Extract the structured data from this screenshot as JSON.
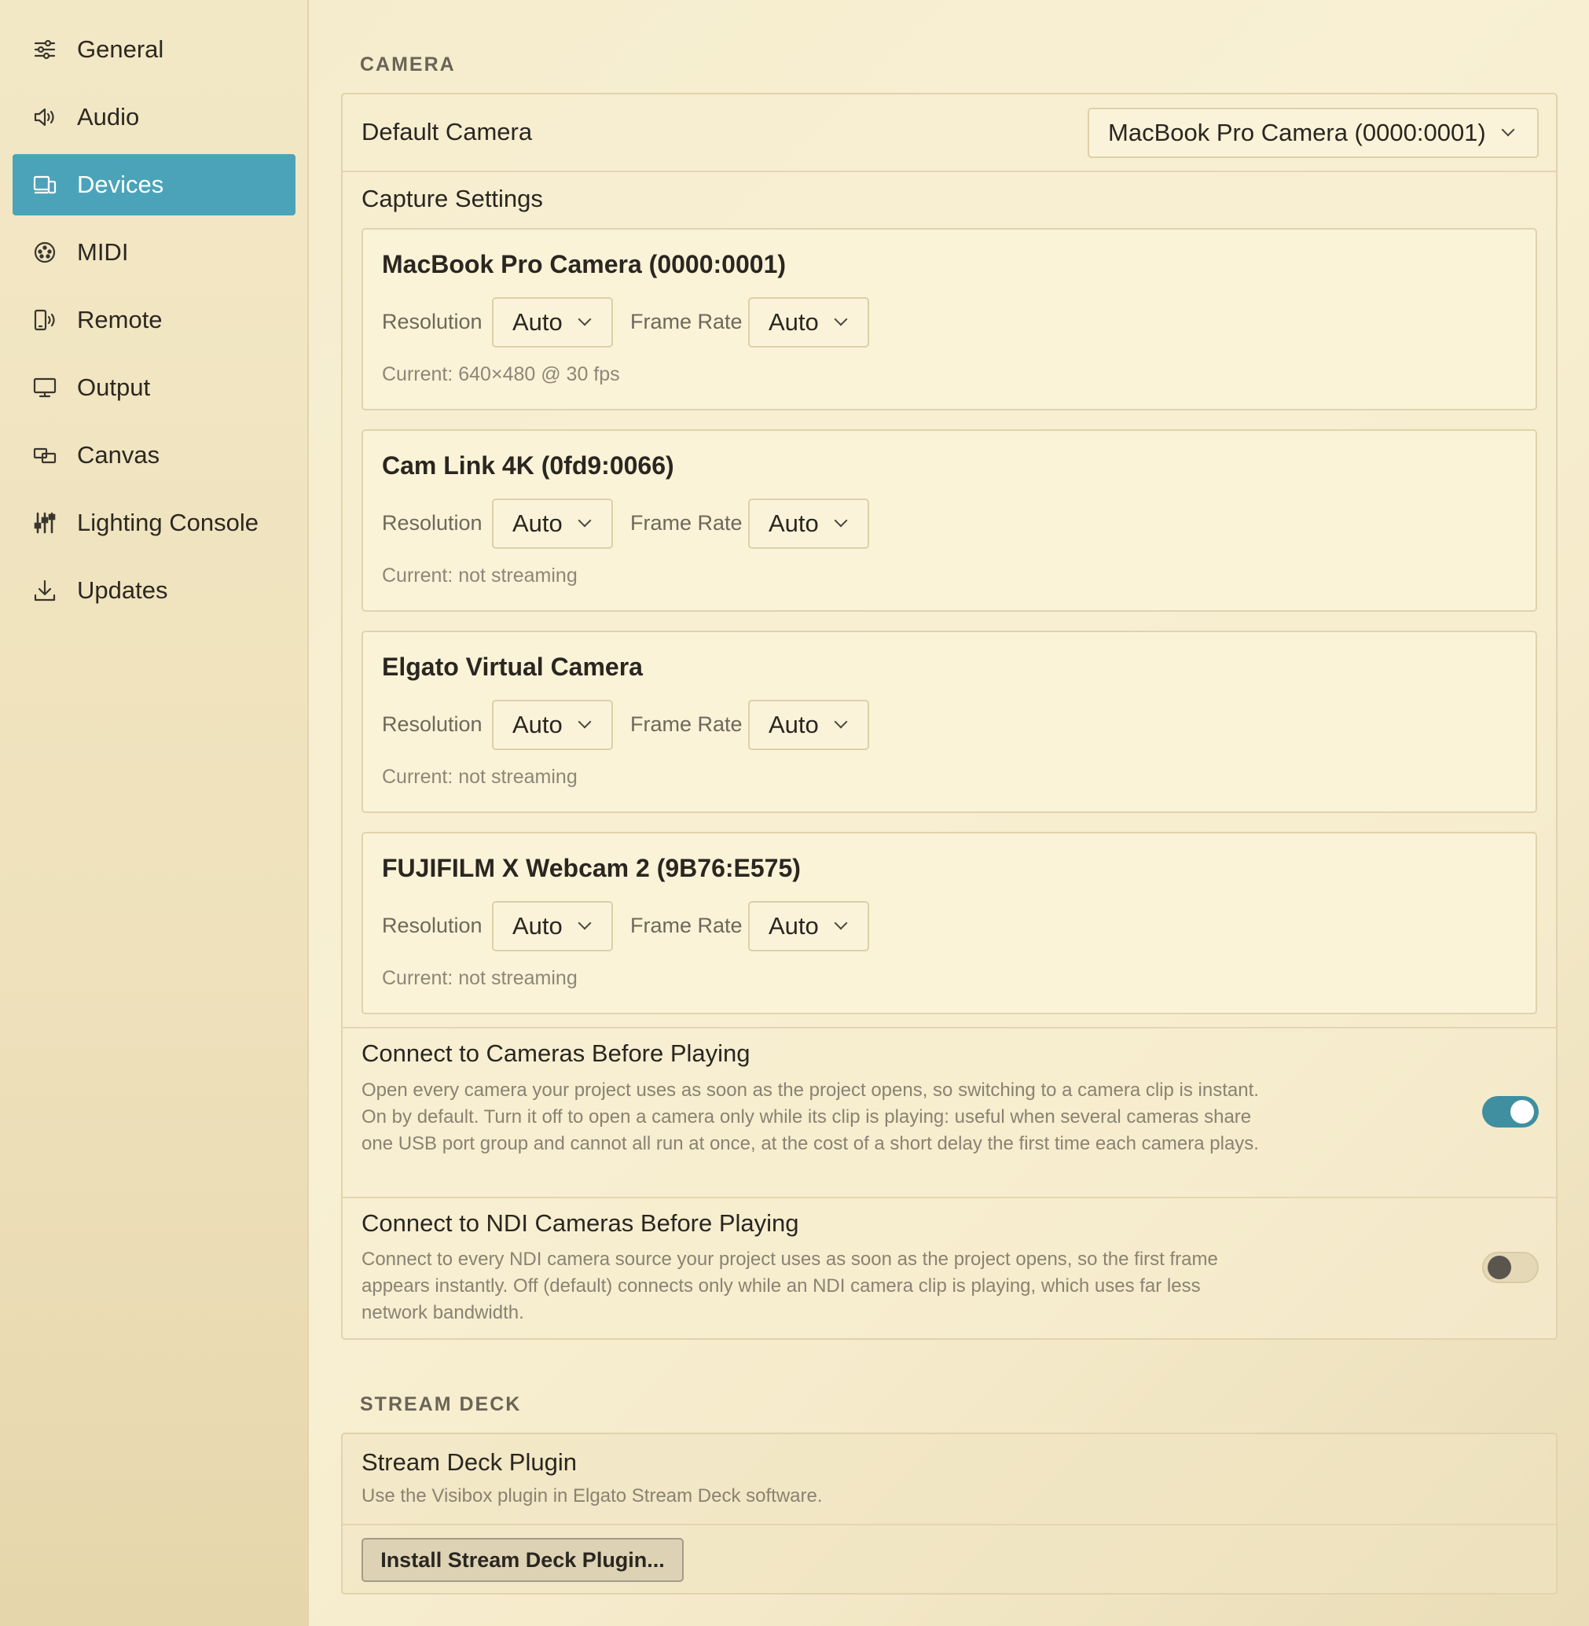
{
  "sidebar": {
    "items": [
      {
        "label": "General",
        "icon": "sliders-icon",
        "active": false
      },
      {
        "label": "Audio",
        "icon": "speaker-icon",
        "active": false
      },
      {
        "label": "Devices",
        "icon": "devices-icon",
        "active": true
      },
      {
        "label": "MIDI",
        "icon": "midi-icon",
        "active": false
      },
      {
        "label": "Remote",
        "icon": "remote-icon",
        "active": false
      },
      {
        "label": "Output",
        "icon": "monitor-icon",
        "active": false
      },
      {
        "label": "Canvas",
        "icon": "canvas-icon",
        "active": false
      },
      {
        "label": "Lighting Console",
        "icon": "faders-icon",
        "active": false
      },
      {
        "label": "Updates",
        "icon": "download-icon",
        "active": false
      }
    ]
  },
  "camera": {
    "heading": "CAMERA",
    "default_camera": {
      "label": "Default Camera",
      "value": "MacBook Pro Camera (0000:0001)"
    },
    "capture_settings_label": "Capture Settings",
    "devices": [
      {
        "name": "MacBook Pro Camera (0000:0001)",
        "resolution_label": "Resolution",
        "resolution": "Auto",
        "frame_rate_label": "Frame Rate",
        "frame_rate": "Auto",
        "current": "Current: 640×480 @ 30 fps"
      },
      {
        "name": "Cam Link 4K (0fd9:0066)",
        "resolution_label": "Resolution",
        "resolution": "Auto",
        "frame_rate_label": "Frame Rate",
        "frame_rate": "Auto",
        "current": "Current: not streaming"
      },
      {
        "name": "Elgato Virtual Camera",
        "resolution_label": "Resolution",
        "resolution": "Auto",
        "frame_rate_label": "Frame Rate",
        "frame_rate": "Auto",
        "current": "Current: not streaming"
      },
      {
        "name": "FUJIFILM X Webcam 2 (9B76:E575)",
        "resolution_label": "Resolution",
        "resolution": "Auto",
        "frame_rate_label": "Frame Rate",
        "frame_rate": "Auto",
        "current": "Current: not streaming"
      }
    ],
    "connect_before_playing": {
      "title": "Connect to Cameras Before Playing",
      "description": "Open every camera your project uses as soon as the project opens, so switching to a camera clip is instant. On by default. Turn it off to open a camera only while its clip is playing: useful when several cameras share one USB port group and cannot all run at once, at the cost of a short delay the first time each camera plays.",
      "enabled": true
    },
    "connect_ndi_before_playing": {
      "title": "Connect to NDI Cameras Before Playing",
      "description": "Connect to every NDI camera source your project uses as soon as the project opens, so the first frame appears instantly. Off (default) connects only while an NDI camera clip is playing, which uses far less network bandwidth.",
      "enabled": false
    }
  },
  "stream_deck": {
    "heading": "STREAM DECK",
    "plugin_title": "Stream Deck Plugin",
    "plugin_description": "Use the Visibox plugin in Elgato Stream Deck software.",
    "install_button": "Install Stream Deck Plugin..."
  },
  "colors": {
    "accent": "#4ba3b9",
    "toggle_on": "#3f8fa0"
  }
}
